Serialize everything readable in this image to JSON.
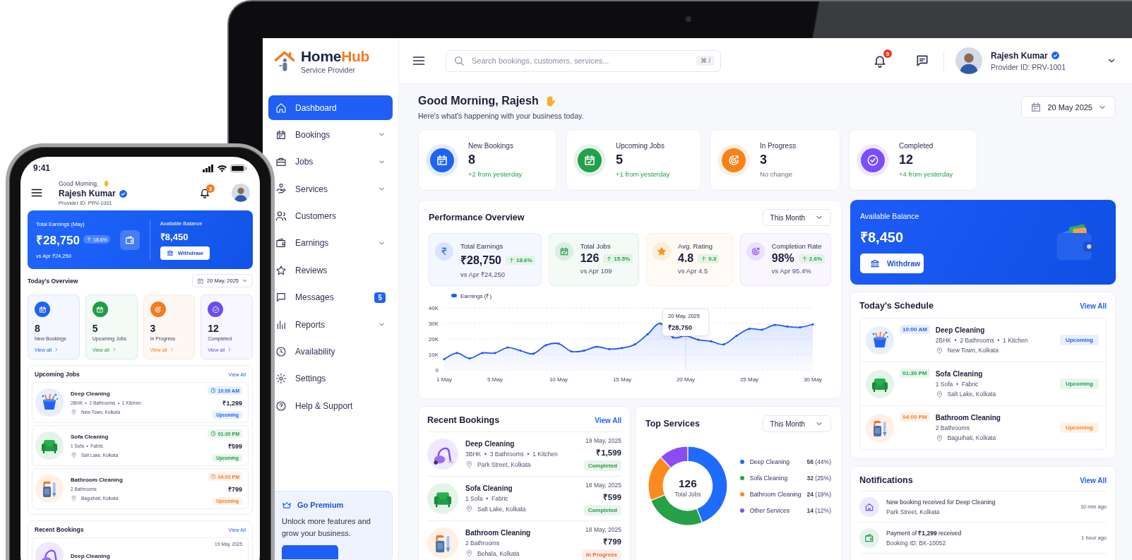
{
  "phone": {
    "status_time": "9:41",
    "greeting": "Good Morning,",
    "name": "Rajesh Kumar",
    "provider_id": "Provider ID: PRV-1001",
    "notification_count": "3",
    "earnings": {
      "label": "Total Earnings (May)",
      "amount": "₹28,750",
      "change": "18.6%",
      "compare": "vs Apr ₹24,250",
      "balance_label": "Available Balance",
      "balance": "₹8,450",
      "withdraw": "Withdraw"
    },
    "overview": {
      "title": "Today's Overview",
      "date": "20 May, 2025",
      "stats": [
        {
          "value": "8",
          "label": "New Bookings",
          "link": "View all",
          "color": "#1f63f5"
        },
        {
          "value": "5",
          "label": "Upcoming Jobs",
          "link": "View all",
          "color": "#1f9d46"
        },
        {
          "value": "3",
          "label": "In Progress",
          "link": "View all",
          "color": "#f47b20"
        },
        {
          "value": "12",
          "label": "Completed",
          "link": "View all",
          "color": "#6c4ee8"
        }
      ]
    },
    "upcoming": {
      "title": "Upcoming Jobs",
      "view_all": "View All",
      "jobs": [
        {
          "title": "Deep Cleaning",
          "details": "2BHK  •  2 Bathrooms  •  1 Kitchen",
          "location": "New Town, Kolkata",
          "time": "10:00 AM",
          "price": "₹1,299",
          "status": "Upcoming",
          "color": "#1f63f5"
        },
        {
          "title": "Sofa Cleaning",
          "details": "1 Sofa  •  Fabric",
          "location": "Salt Lake, Kolkata",
          "time": "01:30 PM",
          "price": "₹599",
          "status": "Upcoming",
          "color": "#1f9d46"
        },
        {
          "title": "Bathroom Cleaning",
          "details": "2 Bathrooms",
          "location": "Baguihati, Kolkata",
          "time": "04:00 PM",
          "price": "₹799",
          "status": "Upcoming",
          "color": "#f47b20"
        }
      ]
    },
    "recent": {
      "title": "Recent Bookings",
      "view_all": "View All",
      "first": {
        "title": "Deep Cleaning",
        "date": "19 May, 2025"
      }
    }
  },
  "laptop": {
    "brand": {
      "parts": [
        "Home",
        "Hub"
      ],
      "subtitle": "Service Provider"
    },
    "nav": [
      {
        "label": "Dashboard",
        "selected": true,
        "expandable": false
      },
      {
        "label": "Bookings",
        "selected": false,
        "expandable": true
      },
      {
        "label": "Jobs",
        "selected": false,
        "expandable": true
      },
      {
        "label": "Services",
        "selected": false,
        "expandable": true
      },
      {
        "label": "Customers",
        "selected": false,
        "expandable": false
      },
      {
        "label": "Earnings",
        "selected": false,
        "expandable": true
      },
      {
        "label": "Reviews",
        "selected": false,
        "expandable": false
      },
      {
        "label": "Messages",
        "selected": false,
        "expandable": false,
        "badge": "5"
      },
      {
        "label": "Reports",
        "selected": false,
        "expandable": true
      },
      {
        "label": "Availability",
        "selected": false,
        "expandable": false
      },
      {
        "label": "Settings",
        "selected": false,
        "expandable": false
      },
      {
        "label": "Help & Support",
        "selected": false,
        "expandable": false
      }
    ],
    "premium": {
      "title": "Go Premium",
      "text": "Unlock more features and grow your business."
    },
    "search": {
      "placeholder": "Search bookings, customers, services...",
      "shortcut": "⌘ /"
    },
    "notification_count": "5",
    "user": {
      "name": "Rajesh Kumar",
      "provider_id": "Provider ID: PRV-1001"
    },
    "greeting": "Good Morning, Rajesh",
    "subtitle": "Here's what's happening with your business today.",
    "date": "20 May 2025",
    "stats": [
      {
        "label": "New Bookings",
        "value": "8",
        "note": "+2 from yesterday",
        "positive": true,
        "color": "#1f63f5"
      },
      {
        "label": "Upcoming Jobs",
        "value": "5",
        "note": "+1 from yesterday",
        "positive": true,
        "color": "#22a04b"
      },
      {
        "label": "In Progress",
        "value": "3",
        "note": "No change",
        "positive": false,
        "color": "#f7821b"
      },
      {
        "label": "Completed",
        "value": "12",
        "note": "+4 from yesterday",
        "positive": true,
        "color": "#7c4dff"
      }
    ],
    "performance": {
      "title": "Performance Overview",
      "period": "This Month",
      "metrics": [
        {
          "label": "Total Earnings",
          "value": "₹28,750",
          "change": "18.6%",
          "compare": "vs Apr ₹24,250",
          "color": "#1f63f5"
        },
        {
          "label": "Total Jobs",
          "value": "126",
          "change": "15.5%",
          "compare": "vs Apr 109",
          "color": "#22a04b"
        },
        {
          "label": "Avg. Rating",
          "value": "4.8",
          "change": "0.3",
          "compare": "vs Apr 4.5",
          "color": "#f7941d"
        },
        {
          "label": "Completion Rate",
          "value": "98%",
          "change": "2.6%",
          "compare": "vs Apr 95.4%",
          "color": "#8b4cf5"
        }
      ],
      "tooltip_value": "₹28,750",
      "chart_data": {
        "type": "area",
        "categories": [
          "1 May",
          null,
          null,
          null,
          "5 May",
          null,
          null,
          null,
          null,
          "10 May",
          null,
          null,
          null,
          null,
          "15 May",
          null,
          null,
          null,
          null,
          "20 May",
          null,
          null,
          null,
          null,
          "25 May",
          null,
          null,
          null,
          null,
          "30 May"
        ],
        "series": [
          {
            "name": "Earnings (₹)",
            "color": "#1f5cf5",
            "values": [
              7000,
              11000,
              7500,
              11000,
              11000,
              14500,
              12500,
              10500,
              16000,
              17000,
              12000,
              12500,
              15000,
              13500,
              14200,
              16500,
              23000,
              30000,
              21000,
              22000,
              19500,
              18500,
              16500,
              22000,
              26500,
              26000,
              29000,
              28000,
              27500,
              29400
            ]
          }
        ],
        "ylim": [
          0,
          40000
        ],
        "grid": true,
        "yticks": [
          {
            "value": 0,
            "label": "0"
          },
          {
            "value": 10000,
            "label": "10K"
          },
          {
            "value": 20000,
            "label": "20K"
          },
          {
            "value": 30000,
            "label": "30K"
          },
          {
            "value": 40000,
            "label": "40K"
          }
        ],
        "annotations": [
          "20 May, 2025"
        ]
      }
    },
    "balance": {
      "label": "Available Balance",
      "amount": "₹8,450",
      "withdraw": "Withdraw"
    },
    "schedule": {
      "title": "Today's Schedule",
      "view_all": "View All",
      "items": [
        {
          "time": "10:00 AM",
          "title": "Deep Cleaning",
          "details": "2BHK  •  2 Bathrooms  •  1 Kitchen",
          "location": "New Town, Kolkata",
          "status": "Upcoming",
          "color": "#1f63f5"
        },
        {
          "time": "01:30 PM",
          "title": "Sofa Cleaning",
          "details": "1 Sofa  •  Fabric",
          "location": "Salt Lake, Kolkata",
          "status": "Upcoming",
          "color": "#22a04b"
        },
        {
          "time": "04:00 PM",
          "title": "Bathroom Cleaning",
          "details": "2 Bathrooms",
          "location": "Baguihati, Kolkata",
          "status": "Upcoming",
          "color": "#f7821b"
        }
      ]
    },
    "recent_bookings": {
      "title": "Recent Bookings",
      "view_all": "View All",
      "items": [
        {
          "title": "Deep Cleaning",
          "details": "3BHK  •  3 Bathrooms  •  1 Kitchen",
          "location": "Park Street, Kolkata",
          "date": "19 May, 2025",
          "price": "₹1,599",
          "status": "Completed",
          "color": "#1f9d46"
        },
        {
          "title": "Sofa Cleaning",
          "details": "1 Sofa  •  Fabric",
          "location": "Salt Lake, Kolkata",
          "date": "18 May, 2025",
          "price": "₹599",
          "status": "Completed",
          "color": "#1f9d46"
        },
        {
          "title": "Bathroom Cleaning",
          "details": "2 Bathrooms",
          "location": "Behala, Kolkata",
          "date": "18 May, 2025",
          "price": "₹799",
          "status": "In Progress",
          "color": "#f0602a"
        }
      ]
    },
    "top_services": {
      "title": "Top Services",
      "period": "This Month",
      "center_value": "126",
      "center_label": "Total Jobs",
      "chart_data": {
        "type": "donut",
        "categories": [
          "Deep Cleaning",
          "Sofa Cleaning",
          "Bathroom Cleaning",
          "Other Services"
        ],
        "values": [
          44,
          25,
          19,
          12
        ],
        "legend": "right"
      },
      "legend": [
        {
          "value": "**56** (44%)",
          "color": "#1f6bff"
        },
        {
          "value": "**32** (25%)",
          "color": "#27a047"
        },
        {
          "value": "**24** (19%)",
          "color": "#fb8a1e"
        },
        {
          "value": "**14** (12%)",
          "color": "#8b4cf5"
        }
      ]
    },
    "notifications": {
      "title": "Notifications",
      "view_all": "View All",
      "items": [
        {
          "text": "New booking received for Deep Cleaning",
          "sub": "Park Street, Kolkata",
          "time": "10 min ago",
          "color": "#6c4ee8"
        },
        {
          "text": "Payment of **₹1,299** received",
          "sub": "Booking ID: BK-10052",
          "time": "1 hour ago",
          "color": "#22a04b"
        }
      ]
    }
  }
}
